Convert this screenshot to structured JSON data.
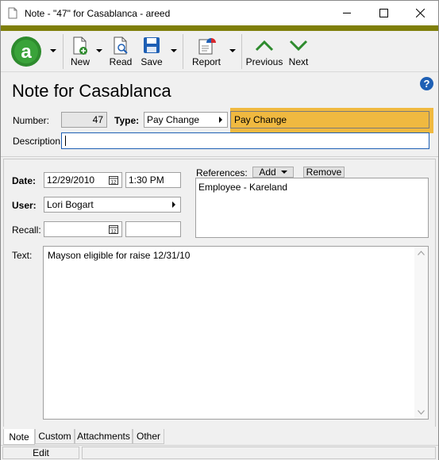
{
  "window": {
    "title": "Note - \"47\" for Casablanca - areed",
    "minimize_glyph": "—",
    "maximize_glyph": "☐",
    "close_glyph": "✕"
  },
  "toolbar": {
    "app_logo": "a",
    "new_label": "New",
    "read_label": "Read",
    "save_label": "Save",
    "report_label": "Report",
    "previous_label": "Previous",
    "next_label": "Next",
    "accent_color": "#2e8b2e",
    "brand_bar_color": "#7f7f0a"
  },
  "header": {
    "page_title": "Note for Casablanca",
    "number_label": "Number:",
    "number_value": "47",
    "type_label": "Type:",
    "type_value": "Pay Change",
    "type_description": "Pay Change",
    "highlight_color": "#f0b940",
    "description_label": "Description:",
    "description_value": ""
  },
  "details": {
    "date_label": "Date:",
    "date_value": "12/29/2010",
    "time_value": "1:30 PM",
    "user_label": "User:",
    "user_value": "Lori Bogart",
    "recall_label": "Recall:",
    "recall_date_value": "",
    "recall_time_value": "",
    "references_label": "References:",
    "add_label": "Add",
    "remove_label": "Remove",
    "references": [
      "Employee - Kareland"
    ],
    "text_label": "Text:",
    "text_value": "Mayson eligible for raise 12/31/10"
  },
  "tabs": [
    "Note",
    "Custom",
    "Attachments",
    "Other"
  ],
  "status": {
    "mode": "Edit"
  }
}
